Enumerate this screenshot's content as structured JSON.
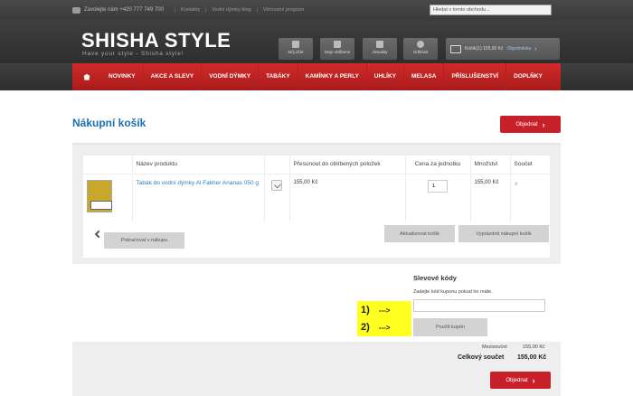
{
  "topbar": {
    "phone": "Zavolejte nám +420 777 749 700",
    "links": [
      "Kontakty",
      "Vodní dýmky blog",
      "Věrnostní program"
    ],
    "search_placeholder": "Hledat v tomto obchodu..."
  },
  "header": {
    "logo": "SHISHA STYLE",
    "tagline": "Have your style - Shisha style!",
    "buttons": [
      "Můj účet",
      "Moje oblíbené",
      "Aktuality",
      "Odhlásit"
    ],
    "cart_text": "Košík(1) 155,00 Kč",
    "cart_order": "Objednávka"
  },
  "nav": {
    "items": [
      "NOVINKY",
      "AKCE A SLEVY",
      "VODNÍ DÝMKY",
      "TABÁKY",
      "KAMÍNKY A PERLY",
      "UHLÍKY",
      "MELASA",
      "PŘÍSLUŠENSTVÍ",
      "DOPLŇKY"
    ]
  },
  "page": {
    "title": "Nákupní košík",
    "order_button": "Objednat"
  },
  "cart": {
    "headers": [
      "Název produktu",
      "Přesunout do oblíbených položek",
      "Cena za jednotku",
      "Množství",
      "Součet"
    ],
    "items": [
      {
        "name": "Tabák do vodní dýmky Al Fakher Ananas 050 g",
        "unit_price": "155,00 Kč",
        "qty": "1",
        "total": "155,00 Kč",
        "remove": "×"
      }
    ],
    "continue_button": "Pokračovat v nákupu",
    "update_button": "Aktualizovat košík",
    "empty_button": "Vyprázdnit nákupní košík"
  },
  "discount": {
    "title": "Slevové kódy",
    "subtitle": "Zadejte kód kuponu pokud ho máte.",
    "apply_button": "Použít kupón",
    "markers": [
      {
        "num": "1)",
        "arrow": "--->"
      },
      {
        "num": "2)",
        "arrow": "--->"
      }
    ]
  },
  "totals": {
    "subtotal_label": "Mezisoučet",
    "subtotal_value": "155,00 Kč",
    "grand_label": "Celkový součet",
    "grand_value": "155,00 Kč",
    "order_button": "Objednat"
  },
  "colors": {
    "accent_red": "#c8202a",
    "link_blue": "#1a6fb0",
    "highlight_yellow": "#ffff20"
  }
}
